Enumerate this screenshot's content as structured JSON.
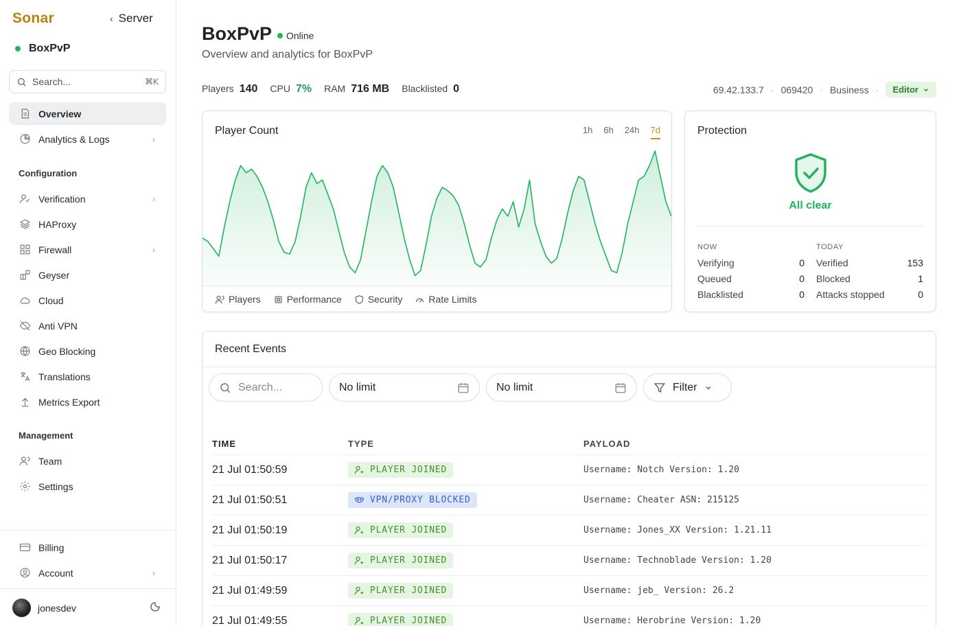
{
  "sidebar": {
    "logo": "Sonar",
    "back_label": "Server",
    "server_name": "BoxPvP",
    "search_placeholder": "Search...",
    "search_shortcut": "⌘K",
    "top_items": [
      {
        "label": "Overview",
        "icon": "document-icon",
        "active": true
      },
      {
        "label": "Analytics & Logs",
        "icon": "pie-chart-icon",
        "chevron": true
      }
    ],
    "config_label": "Configuration",
    "config_items": [
      {
        "label": "Verification",
        "icon": "user-check-icon",
        "chevron": true
      },
      {
        "label": "HAProxy",
        "icon": "layers-icon"
      },
      {
        "label": "Firewall",
        "icon": "firewall-icon",
        "chevron": true
      },
      {
        "label": "Geyser",
        "icon": "blocks-icon"
      },
      {
        "label": "Cloud",
        "icon": "cloud-icon"
      },
      {
        "label": "Anti VPN",
        "icon": "eye-off-icon"
      },
      {
        "label": "Geo Blocking",
        "icon": "globe-icon"
      },
      {
        "label": "Translations",
        "icon": "translate-icon"
      },
      {
        "label": "Metrics Export",
        "icon": "upload-icon"
      }
    ],
    "management_label": "Management",
    "management_items": [
      {
        "label": "Team",
        "icon": "users-icon"
      },
      {
        "label": "Settings",
        "icon": "gear-icon"
      }
    ],
    "bottom_items": [
      {
        "label": "Billing",
        "icon": "credit-card-icon"
      },
      {
        "label": "Account",
        "icon": "user-circle-icon",
        "chevron": true
      }
    ],
    "username": "jonesdev"
  },
  "header": {
    "title": "BoxPvP",
    "status": "Online",
    "subtitle": "Overview and analytics for BoxPvP",
    "stats": {
      "players_label": "Players",
      "players": "140",
      "cpu_label": "CPU",
      "cpu": "7%",
      "ram_label": "RAM",
      "ram": "716 MB",
      "blacklisted_label": "Blacklisted",
      "blacklisted": "0"
    },
    "ip": "69.42.133.7",
    "id": "069420",
    "plan": "Business",
    "role": "Editor"
  },
  "player_chart": {
    "title": "Player Count",
    "ranges": [
      "1h",
      "6h",
      "24h",
      "7d"
    ],
    "active_range": "7d",
    "tabs": [
      "Players",
      "Performance",
      "Security",
      "Rate Limits"
    ],
    "line_color": "#22b35e"
  },
  "chart_data": {
    "type": "area",
    "title": "Player Count",
    "xlabel": "",
    "ylabel": "",
    "grid": false,
    "values": [
      60,
      55,
      45,
      35,
      75,
      110,
      140,
      160,
      150,
      155,
      145,
      130,
      110,
      85,
      55,
      40,
      38,
      55,
      90,
      130,
      150,
      135,
      140,
      120,
      100,
      70,
      40,
      20,
      12,
      30,
      70,
      110,
      145,
      160,
      150,
      130,
      95,
      60,
      30,
      8,
      15,
      50,
      90,
      115,
      130,
      125,
      118,
      105,
      80,
      50,
      25,
      20,
      30,
      60,
      85,
      100,
      90,
      110,
      75,
      100,
      140,
      80,
      55,
      35,
      25,
      32,
      60,
      95,
      125,
      145,
      140,
      110,
      80,
      55,
      35,
      15,
      12,
      40,
      80,
      110,
      140,
      145,
      160,
      180,
      145,
      110,
      90
    ]
  },
  "protection": {
    "title": "Protection",
    "status": "All clear",
    "now_label": "NOW",
    "today_label": "TODAY",
    "now": [
      {
        "label": "Verifying",
        "value": "0"
      },
      {
        "label": "Queued",
        "value": "0"
      },
      {
        "label": "Blacklisted",
        "value": "0"
      }
    ],
    "today": [
      {
        "label": "Verified",
        "value": "153"
      },
      {
        "label": "Blocked",
        "value": "1"
      },
      {
        "label": "Attacks stopped",
        "value": "0"
      }
    ]
  },
  "events": {
    "title": "Recent Events",
    "search_placeholder": "Search...",
    "from_label": "No limit",
    "to_label": "No limit",
    "filter_label": "Filter",
    "columns": [
      "TIME",
      "TYPE",
      "PAYLOAD"
    ],
    "rows": [
      {
        "time": "21 Jul 01:50:59",
        "type": "PLAYER JOINED",
        "kind": "join",
        "payload": "Username: Notch Version: 1.20"
      },
      {
        "time": "21 Jul 01:50:51",
        "type": "VPN/PROXY BLOCKED",
        "kind": "block",
        "payload": "Username: Cheater ASN: 215125"
      },
      {
        "time": "21 Jul 01:50:19",
        "type": "PLAYER JOINED",
        "kind": "join",
        "payload": "Username: Jones_XX Version: 1.21.11"
      },
      {
        "time": "21 Jul 01:50:17",
        "type": "PLAYER JOINED",
        "kind": "join",
        "payload": "Username: Technoblade Version: 1.20"
      },
      {
        "time": "21 Jul 01:49:59",
        "type": "PLAYER JOINED",
        "kind": "join",
        "payload": "Username: jeb_ Version: 26.2"
      },
      {
        "time": "21 Jul 01:49:55",
        "type": "PLAYER JOINED",
        "kind": "join",
        "payload": "Username: Herobrine Version: 1.20"
      }
    ]
  }
}
